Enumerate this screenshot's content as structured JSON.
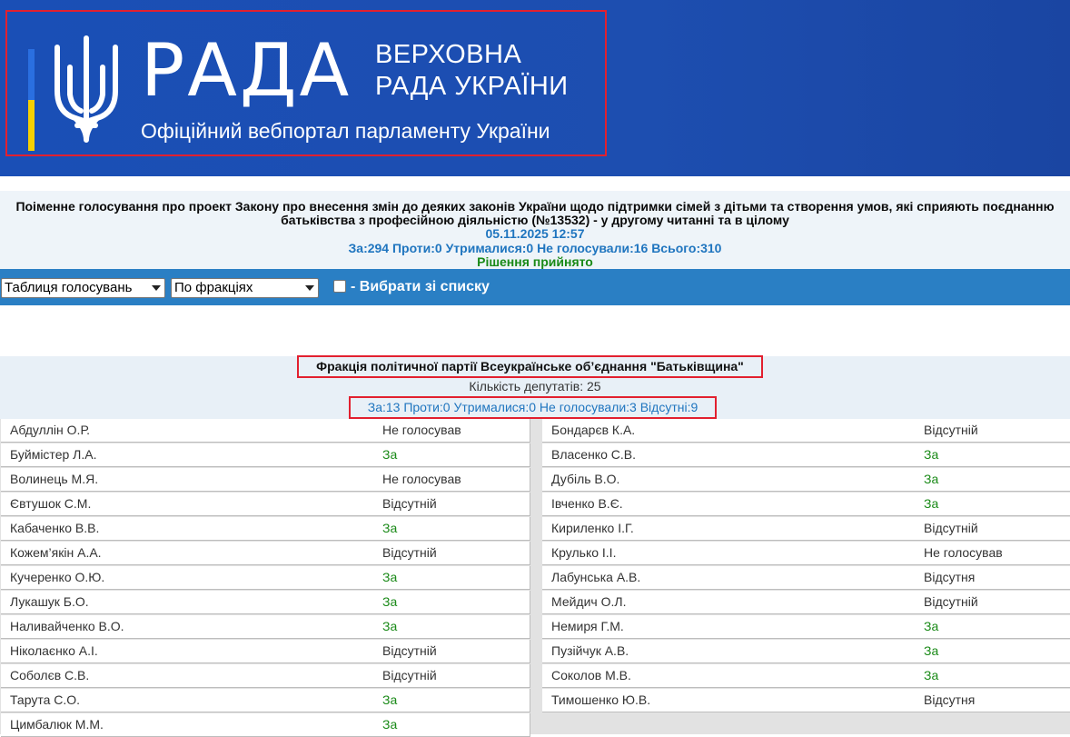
{
  "header": {
    "logo_title": "РАДА",
    "logo_subtitle_line1": "ВЕРХОВНА",
    "logo_subtitle_line2": "РАДА УКРАЇНИ",
    "portal_title": "Офіційний вебпортал парламенту України"
  },
  "vote": {
    "title": "Поіменне голосування про проект Закону про внесення змін до деяких законів України щодо підтримки сімей з дітьми та створення умов, які сприяють поєднанню батьківства з професійною діяльністю (№13532) - у другому читанні та в цілому",
    "datetime": "05.11.2025 12:57",
    "totals": "За:294 Проти:0 Утрималися:0 Не голосували:16 Всього:310",
    "result": "Рішення прийнято"
  },
  "toolbar": {
    "view_select": "Таблиця голосувань",
    "group_select": "По фракціях",
    "choose_label": "- Вибрати зі списку"
  },
  "faction": {
    "name": "Фракція політичної партії Всеукраїнське об’єднання \"Батьківщина\"",
    "deputy_count": "Кількість депутатів: 25",
    "stats": "За:13 Проти:0 Утрималися:0 Не голосували:3 Відсутні:9"
  },
  "colors": {
    "header_bg": "#1d4eb0",
    "toolbar_bg": "#2a7fc4",
    "highlight_border": "#e2202f",
    "vote_for": "#1a8a18",
    "info_blue": "#1f75bf"
  },
  "deputies_left": [
    {
      "name": "Абдуллін О.Р.",
      "vote": "Не голосував"
    },
    {
      "name": "Буймістер Л.А.",
      "vote": "За"
    },
    {
      "name": "Волинець М.Я.",
      "vote": "Не голосував"
    },
    {
      "name": "Євтушок С.М.",
      "vote": "Відсутній"
    },
    {
      "name": "Кабаченко В.В.",
      "vote": "За"
    },
    {
      "name": "Кожем’якін А.А.",
      "vote": "Відсутній"
    },
    {
      "name": "Кучеренко О.Ю.",
      "vote": "За"
    },
    {
      "name": "Лукашук Б.О.",
      "vote": "За"
    },
    {
      "name": "Наливайченко В.О.",
      "vote": "За"
    },
    {
      "name": "Ніколаєнко А.І.",
      "vote": "Відсутній"
    },
    {
      "name": "Соболєв С.В.",
      "vote": "Відсутній"
    },
    {
      "name": "Тарута С.О.",
      "vote": "За"
    },
    {
      "name": "Цимбалюк М.М.",
      "vote": "За"
    }
  ],
  "deputies_right": [
    {
      "name": "Бондарєв К.А.",
      "vote": "Відсутній"
    },
    {
      "name": "Власенко С.В.",
      "vote": "За"
    },
    {
      "name": "Дубіль В.О.",
      "vote": "За"
    },
    {
      "name": "Івченко В.Є.",
      "vote": "За"
    },
    {
      "name": "Кириленко І.Г.",
      "vote": "Відсутній"
    },
    {
      "name": "Крулько І.І.",
      "vote": "Не голосував"
    },
    {
      "name": "Лабунська А.В.",
      "vote": "Відсутня"
    },
    {
      "name": "Мейдич О.Л.",
      "vote": "Відсутній"
    },
    {
      "name": "Немиря Г.М.",
      "vote": "За"
    },
    {
      "name": "Пузійчук А.В.",
      "vote": "За"
    },
    {
      "name": "Соколов М.В.",
      "vote": "За"
    },
    {
      "name": "Тимошенко Ю.В.",
      "vote": "Відсутня"
    }
  ]
}
